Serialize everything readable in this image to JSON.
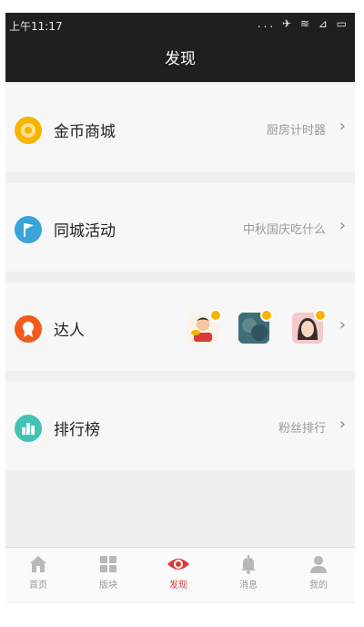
{
  "status_bar": {
    "time": "上午11:17",
    "icons": "... ✈ ≋ ⊿ ▭"
  },
  "header": {
    "title": "发现"
  },
  "rows": [
    {
      "label": "金币商城",
      "subtext": "厨房计时器",
      "icon": "coin-icon",
      "color": "#f5b400"
    },
    {
      "label": "同城活动",
      "subtext": "中秋国庆吃什么",
      "icon": "flag-icon",
      "color": "#3aa3d8"
    },
    {
      "label": "达人",
      "subtext": "",
      "icon": "medal-icon",
      "color": "#f25b1d"
    },
    {
      "label": "排行榜",
      "subtext": "粉丝排行",
      "icon": "bar-chart-icon",
      "color": "#44c3b3"
    }
  ],
  "tabs": [
    {
      "label": "首页",
      "icon": "home-icon",
      "active": false
    },
    {
      "label": "版块",
      "icon": "grid-icon",
      "active": false
    },
    {
      "label": "发现",
      "icon": "eye-icon",
      "active": true
    },
    {
      "label": "消息",
      "icon": "bell-icon",
      "active": false
    },
    {
      "label": "我的",
      "icon": "user-icon",
      "active": false
    }
  ],
  "colors": {
    "header_bg": "#1f1f1f",
    "accent": "#d93a3a",
    "badge": "#f5b400"
  }
}
